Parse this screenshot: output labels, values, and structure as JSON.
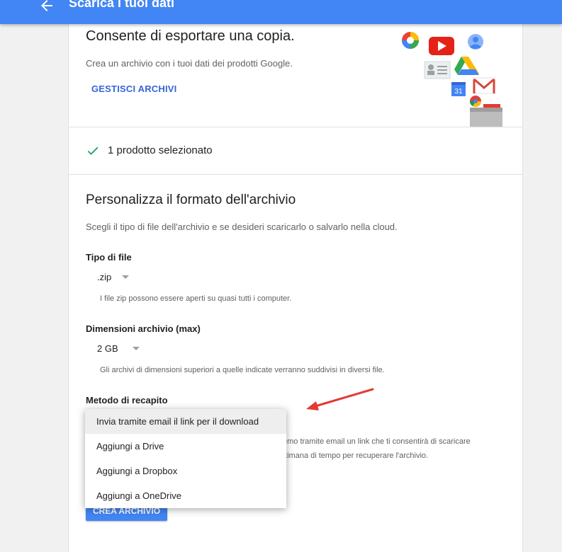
{
  "header": {
    "title": "Scarica i tuoi dati",
    "background": "#4285f4"
  },
  "intro": {
    "title": "Consente di esportare una copia.",
    "description": "Crea un archivio con i tuoi dati dei prodotti Google.",
    "manage_link": "GESTISCI ARCHIVI"
  },
  "illustration": {
    "icons": [
      "photos-icon",
      "youtube-icon",
      "profile-icon",
      "contacts-icon",
      "drive-icon",
      "calendar-icon",
      "gmail-icon",
      "chrome-icon",
      "archive-box-icon"
    ],
    "calendar_day": "31"
  },
  "selection": {
    "summary": "1 prodotto selezionato"
  },
  "format": {
    "title": "Personalizza il formato dell'archivio",
    "description": "Scegli il tipo di file dell'archivio e se desideri scaricarlo o salvarlo nella cloud.",
    "file_type": {
      "label": "Tipo di file",
      "value": ".zip",
      "hint": "I file zip possono essere aperti su quasi tutti i computer."
    },
    "archive_size": {
      "label": "Dimensioni archivio (max)",
      "value": "2 GB",
      "hint": "Gli archivi di dimensioni superiori a quelle indicate verranno suddivisi in diversi file."
    },
    "delivery": {
      "label": "Metodo di recapito",
      "hint_line1": "emo tramite email un link che ti consentirà di scaricare",
      "hint_line2": "ttimana di tempo per recuperare l'archivio.",
      "options": [
        "Invia tramite email il link per il download",
        "Aggiungi a Drive",
        "Aggiungi a Dropbox",
        "Aggiungi a OneDrive"
      ],
      "highlighted_index": 0
    },
    "create_button": "CREA ARCHIVIO"
  },
  "annotation": {
    "arrow_color": "#e53935"
  }
}
